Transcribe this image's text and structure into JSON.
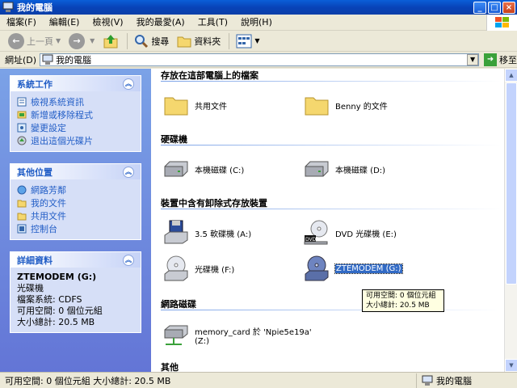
{
  "window": {
    "title": "我的電腦"
  },
  "menu": [
    "檔案(F)",
    "編輯(E)",
    "檢視(V)",
    "我的最愛(A)",
    "工具(T)",
    "說明(H)"
  ],
  "toolbar": {
    "back": "上一頁",
    "search": "搜尋",
    "folders": "資料夾"
  },
  "address": {
    "label": "網址(D)",
    "value": "我的電腦",
    "go": "移至"
  },
  "system_tasks": {
    "title": "系統工作",
    "items": [
      "檢視系統資訊",
      "新增或移除程式",
      "變更設定",
      "退出這個光碟片"
    ]
  },
  "other_places": {
    "title": "其他位置",
    "items": [
      "網路芳鄰",
      "我的文件",
      "共用文件",
      "控制台"
    ]
  },
  "details": {
    "title": "詳細資料",
    "name": "ZTEMODEM (G:)",
    "type": "光碟機",
    "filesystem": "檔案系統: CDFS",
    "free": "可用空間: 0 個位元組",
    "total": "大小總計: 20.5 MB"
  },
  "groups": {
    "files": "存放在這部電腦上的檔案",
    "hdd": "硬碟機",
    "removable": "裝置中含有卸除式存放裝置",
    "network": "網路磁碟",
    "other": "其他"
  },
  "items": {
    "shared_docs": "共用文件",
    "benny_docs": "Benny 的文件",
    "disk_c": "本機磁碟 (C:)",
    "disk_d": "本機磁碟 (D:)",
    "floppy": "3.5 軟碟機 (A:)",
    "dvd": "DVD 光碟機 (E:)",
    "cd_f": "光碟機 (F:)",
    "ztemodem": "ZTEMODEM (G:)",
    "netdrive_1": "memory_card 於 'Npie5e19a'",
    "netdrive_2": "(Z:)"
  },
  "tooltip": {
    "line1": "可用空間: 0 個位元組",
    "line2": "大小總計: 20.5 MB"
  },
  "status": {
    "left": "可用空間: 0 個位元組 大小總計: 20.5 MB",
    "right": "我的電腦"
  },
  "colors": {
    "titlebar": "#0A5FD8",
    "task_link": "#215DC6",
    "selection": "#316AC5"
  }
}
